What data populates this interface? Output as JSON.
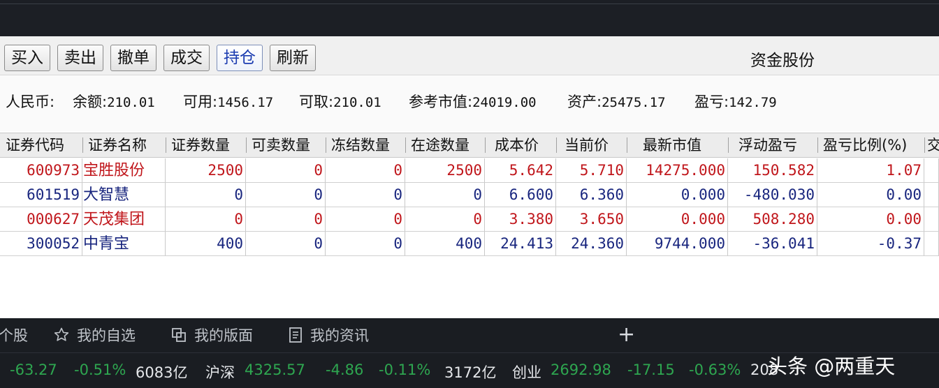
{
  "toolbar": {
    "buttons": [
      "买入",
      "卖出",
      "撤单",
      "成交",
      "持仓",
      "刷新"
    ],
    "active": "持仓",
    "fund_label": "资金股份"
  },
  "summary": {
    "currency": "人民币:",
    "balance_label": "余额:",
    "balance": "210.01",
    "available_label": "可用:",
    "available": "1456.17",
    "withdrawable_label": "可取:",
    "withdrawable": "210.01",
    "market_value_label": "参考市值:",
    "market_value": "24019.00",
    "assets_label": "资产:",
    "assets": "25475.17",
    "pnl_label": "盈亏:",
    "pnl": "142.79"
  },
  "table": {
    "headers": [
      "证券代码",
      "证券名称",
      "证券数量",
      "可卖数量",
      "冻结数量",
      "在途数量",
      "成本价",
      "当前价",
      "最新市值",
      "浮动盈亏",
      "盈亏比例(%)",
      "交"
    ],
    "rows": [
      {
        "code": "600973",
        "name": "宝胜股份",
        "qty": "2500",
        "sellable": "0",
        "frozen": "0",
        "transit": "2500",
        "cost": "5.642",
        "price": "5.710",
        "value": "14275.000",
        "pnl": "150.582",
        "ratio": "1.07",
        "color": "red"
      },
      {
        "code": "601519",
        "name": "大智慧",
        "qty": "0",
        "sellable": "0",
        "frozen": "0",
        "transit": "0",
        "cost": "6.600",
        "price": "6.360",
        "value": "0.000",
        "pnl": "-480.030",
        "ratio": "0.00",
        "color": "blue"
      },
      {
        "code": "000627",
        "name": "天茂集团",
        "qty": "0",
        "sellable": "0",
        "frozen": "0",
        "transit": "0",
        "cost": "3.380",
        "price": "3.650",
        "value": "0.000",
        "pnl": "508.280",
        "ratio": "0.00",
        "color": "red"
      },
      {
        "code": "300052",
        "name": "中青宝",
        "qty": "400",
        "sellable": "0",
        "frozen": "0",
        "transit": "400",
        "cost": "24.413",
        "price": "24.360",
        "value": "9744.000",
        "pnl": "-36.041",
        "ratio": "-0.37",
        "color": "blue"
      }
    ]
  },
  "bottom_tabs": {
    "t0": "个股",
    "t1": "我的自选",
    "t2": "我的版面",
    "t3": "我的资讯",
    "add": "+"
  },
  "ticker": {
    "a1": "-63.27",
    "a2": "-0.51%",
    "a3": "6083亿",
    "b0": "沪深",
    "b1": "4325.57",
    "b2": "-4.86",
    "b3": "-0.11%",
    "b4": "3172亿",
    "c0": "创业",
    "c1": "2692.98",
    "c2": "-17.15",
    "c3": "-0.63%",
    "c4": "208"
  },
  "watermark": "头条 @两重天",
  "colors": {
    "red": "#c0161b",
    "blue": "#18257e",
    "green": "#2ea650",
    "active_tab": "#1a3bb0"
  }
}
